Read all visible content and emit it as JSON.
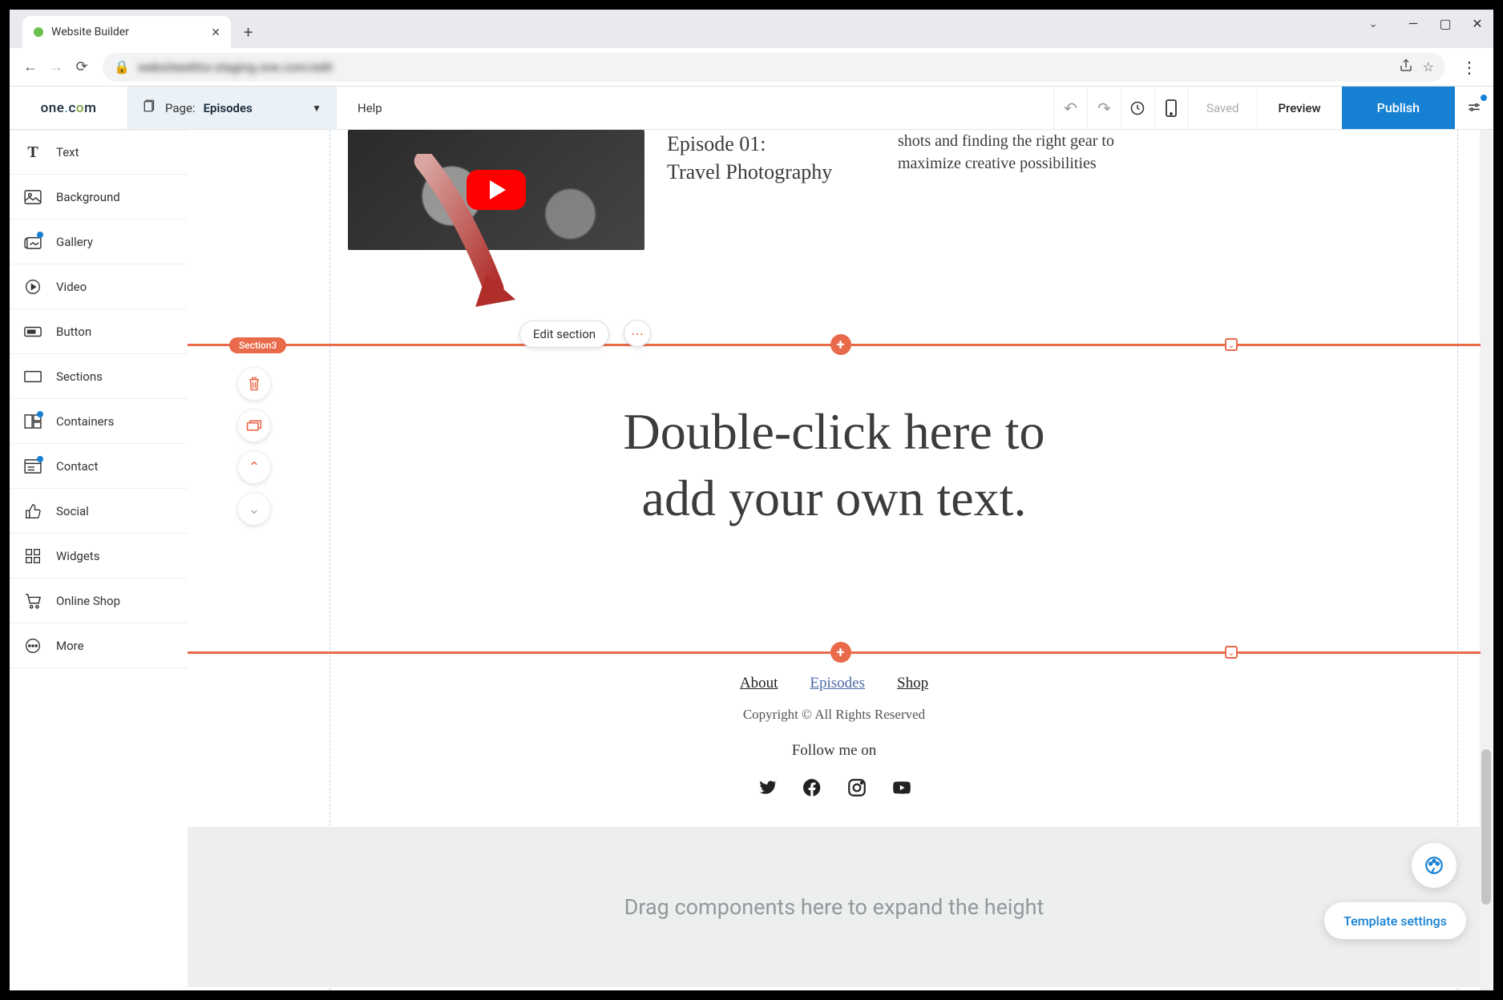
{
  "browser": {
    "tab_title": "Website Builder",
    "url_blurred": "websiteeditor.staging.one.com/edit",
    "window_controls": {
      "minimize": "—",
      "maximize": "▢",
      "close": "✕"
    }
  },
  "topbar": {
    "logo": "one.com",
    "page_label": "Page:",
    "page_name": "Episodes",
    "help": "Help",
    "saved": "Saved",
    "preview": "Preview",
    "publish": "Publish"
  },
  "sidebar": [
    {
      "id": "text",
      "label": "Text",
      "dot": false
    },
    {
      "id": "background",
      "label": "Background",
      "dot": false
    },
    {
      "id": "gallery",
      "label": "Gallery",
      "dot": true
    },
    {
      "id": "video",
      "label": "Video",
      "dot": false
    },
    {
      "id": "button",
      "label": "Button",
      "dot": false
    },
    {
      "id": "sections",
      "label": "Sections",
      "dot": false
    },
    {
      "id": "containers",
      "label": "Containers",
      "dot": true
    },
    {
      "id": "contact",
      "label": "Contact",
      "dot": true
    },
    {
      "id": "social",
      "label": "Social",
      "dot": false
    },
    {
      "id": "widgets",
      "label": "Widgets",
      "dot": false
    },
    {
      "id": "shop",
      "label": "Online Shop",
      "dot": false
    },
    {
      "id": "more",
      "label": "More",
      "dot": false
    }
  ],
  "canvas": {
    "edit_section": "Edit section",
    "section_badge": "Section3",
    "video_card": {
      "title_line1": "Episode 01:",
      "title_line2": "Travel Photography",
      "desc": "shots and finding the right gear to maximize creative possibilities"
    },
    "hero_text_line1": "Double-click here to",
    "hero_text_line2": "add your own text.",
    "footer": {
      "links": [
        "About",
        "Episodes",
        "Shop"
      ],
      "active_link": "Episodes",
      "copyright": "Copyright © All Rights Reserved",
      "follow": "Follow me on"
    },
    "drop_hint": "Drag components here to expand the height",
    "template_settings": "Template settings"
  }
}
